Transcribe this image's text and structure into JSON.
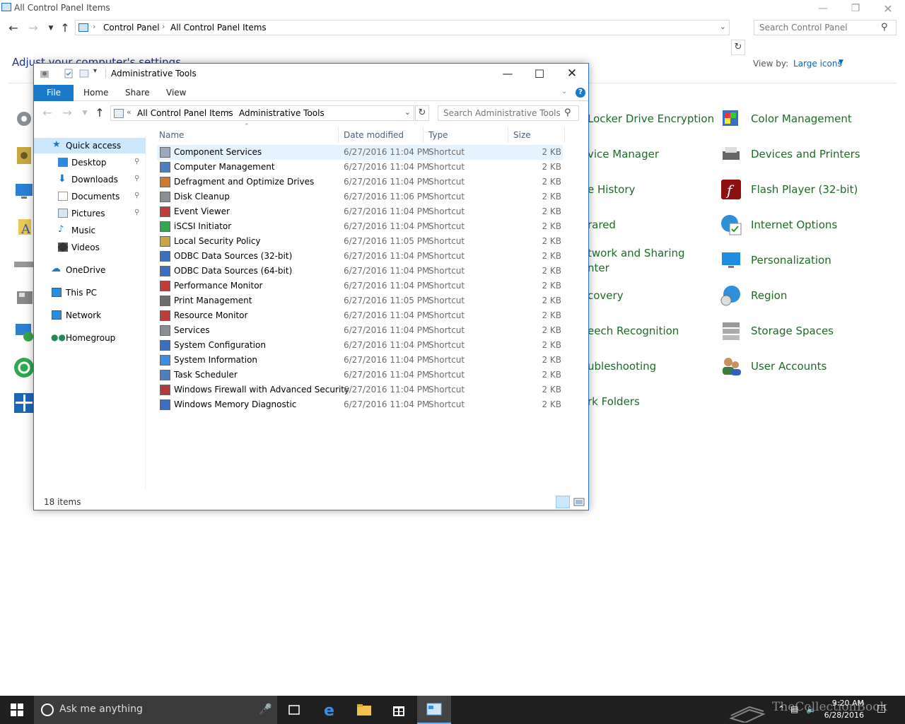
{
  "control_panel": {
    "window_title": "All Control Panel Items",
    "breadcrumb": [
      "Control Panel",
      "All Control Panel Items"
    ],
    "search_placeholder": "Search Control Panel",
    "heading": "Adjust your computer's settings",
    "view_by_label": "View by:",
    "view_by_value": "Large icons",
    "items_col_mid": [
      "Locker Drive Encryption",
      "vice Manager",
      "e History",
      "rared",
      "twork and Sharing",
      "nter",
      "covery",
      "eech Recognition",
      "ubleshooting",
      "rk Folders"
    ],
    "items_col_right": [
      "Color Management",
      "Devices and Printers",
      "Flash Player (32-bit)",
      "Internet Options",
      "Personalization",
      "Region",
      "Storage Spaces",
      "User Accounts"
    ]
  },
  "explorer": {
    "window_title": "Administrative Tools",
    "ribbon_tabs": [
      "File",
      "Home",
      "Share",
      "View"
    ],
    "breadcrumb": [
      "All Control Panel Items",
      "Administrative Tools"
    ],
    "breadcrumb_overflow": "«",
    "search_placeholder": "Search Administrative Tools",
    "nav_pane": {
      "quick_access": "Quick access",
      "pinned": [
        "Desktop",
        "Downloads",
        "Documents",
        "Pictures"
      ],
      "unpinned": [
        "Music",
        "Videos"
      ],
      "onedrive": "OneDrive",
      "this_pc": "This PC",
      "network": "Network",
      "homegroup": "Homegroup"
    },
    "columns": [
      "Name",
      "Date modified",
      "Type",
      "Size"
    ],
    "rows": [
      {
        "name": "Component Services",
        "date": "6/27/2016 11:04 PM",
        "type": "Shortcut",
        "size": "2 KB"
      },
      {
        "name": "Computer Management",
        "date": "6/27/2016 11:04 PM",
        "type": "Shortcut",
        "size": "2 KB"
      },
      {
        "name": "Defragment and Optimize Drives",
        "date": "6/27/2016 11:04 PM",
        "type": "Shortcut",
        "size": "2 KB"
      },
      {
        "name": "Disk Cleanup",
        "date": "6/27/2016 11:06 PM",
        "type": "Shortcut",
        "size": "2 KB"
      },
      {
        "name": "Event Viewer",
        "date": "6/27/2016 11:04 PM",
        "type": "Shortcut",
        "size": "2 KB"
      },
      {
        "name": "iSCSI Initiator",
        "date": "6/27/2016 11:04 PM",
        "type": "Shortcut",
        "size": "2 KB"
      },
      {
        "name": "Local Security Policy",
        "date": "6/27/2016 11:05 PM",
        "type": "Shortcut",
        "size": "2 KB"
      },
      {
        "name": "ODBC Data Sources (32-bit)",
        "date": "6/27/2016 11:04 PM",
        "type": "Shortcut",
        "size": "2 KB"
      },
      {
        "name": "ODBC Data Sources (64-bit)",
        "date": "6/27/2016 11:04 PM",
        "type": "Shortcut",
        "size": "2 KB"
      },
      {
        "name": "Performance Monitor",
        "date": "6/27/2016 11:04 PM",
        "type": "Shortcut",
        "size": "2 KB"
      },
      {
        "name": "Print Management",
        "date": "6/27/2016 11:05 PM",
        "type": "Shortcut",
        "size": "2 KB"
      },
      {
        "name": "Resource Monitor",
        "date": "6/27/2016 11:04 PM",
        "type": "Shortcut",
        "size": "2 KB"
      },
      {
        "name": "Services",
        "date": "6/27/2016 11:04 PM",
        "type": "Shortcut",
        "size": "2 KB"
      },
      {
        "name": "System Configuration",
        "date": "6/27/2016 11:04 PM",
        "type": "Shortcut",
        "size": "2 KB"
      },
      {
        "name": "System Information",
        "date": "6/27/2016 11:04 PM",
        "type": "Shortcut",
        "size": "2 KB"
      },
      {
        "name": "Task Scheduler",
        "date": "6/27/2016 11:04 PM",
        "type": "Shortcut",
        "size": "2 KB"
      },
      {
        "name": "Windows Firewall with Advanced Security",
        "date": "6/27/2016 11:04 PM",
        "type": "Shortcut",
        "size": "2 KB"
      },
      {
        "name": "Windows Memory Diagnostic",
        "date": "6/27/2016 11:04 PM",
        "type": "Shortcut",
        "size": "2 KB"
      }
    ],
    "status": "18 items"
  },
  "taskbar": {
    "search_placeholder": "Ask me anything",
    "time": "9:20 AM",
    "date": "6/28/2016",
    "watermark": "TheCollectionBook"
  },
  "colors": {
    "accent": "#1979ca",
    "cp_link": "#1f6a26",
    "selection": "#cce8ff"
  }
}
